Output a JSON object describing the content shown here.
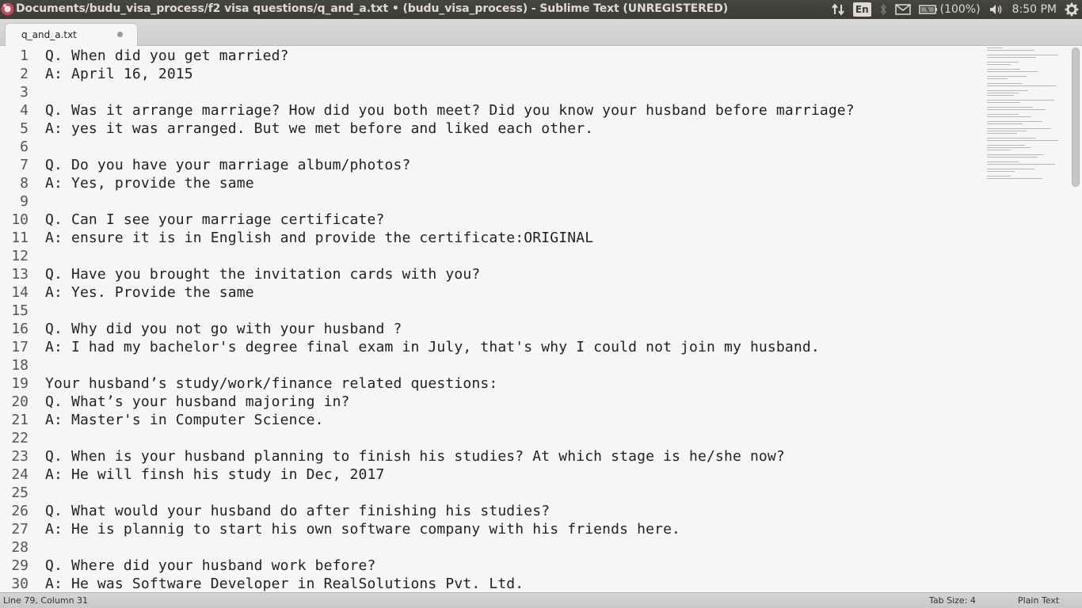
{
  "window": {
    "title": "Documents/budu_visa_process/f2 visa questions/q_and_a.txt • (budu_visa_process) - Sublime Text (UNREGISTERED)"
  },
  "tray": {
    "keyboard_layout": "En",
    "battery": "(100%)",
    "clock": "8:50 PM"
  },
  "tab": {
    "filename": "q_and_a.txt"
  },
  "editor": {
    "line_numbers": [
      "1",
      "2",
      "3",
      "4",
      "5",
      "6",
      "7",
      "8",
      "9",
      "10",
      "11",
      "12",
      "13",
      "14",
      "15",
      "16",
      "17",
      "18",
      "19",
      "20",
      "21",
      "22",
      "23",
      "24",
      "25",
      "26",
      "27",
      "28",
      "29",
      "30"
    ],
    "lines": [
      "Q. When did you get married?",
      "A: April 16, 2015",
      "",
      "Q. Was it arrange marriage? How did you both meet? Did you know your husband before marriage?",
      "A: yes it was arranged. But we met before and liked each other.",
      "",
      "Q. Do you have your marriage album/photos?",
      "A: Yes, provide the same",
      "",
      "Q. Can I see your marriage certificate?",
      "A: ensure it is in English and provide the certificate:ORIGINAL",
      "",
      "Q. Have you brought the invitation cards with you?",
      "A: Yes. Provide the same",
      "",
      "Q. Why did you not go with your husband ?",
      "A: I had my bachelor's degree final exam in July, that's why I could not join my husband.",
      "",
      "Your husband’s study/work/finance related questions:",
      "Q. What’s your husband majoring in?",
      "A: Master's in Computer Science.",
      "",
      "Q. When is your husband planning to finish his studies? At which stage is he/she now?",
      "A: He will finsh his study in Dec, 2017",
      "",
      "Q. What would your husband do after finishing his studies?",
      "A: He is plannig to start his own software company with his friends here.",
      "",
      "Q. Where did your husband work before?",
      "A: He was Software Developer in RealSolutions Pvt. Ltd."
    ]
  },
  "status": {
    "cursor_position": "Line 79, Column 31",
    "tab_size": "Tab Size: 4",
    "syntax": "Plain Text"
  },
  "icons": [
    "sublime-app-icon",
    "network-arrows-icon",
    "bluetooth-icon",
    "mail-icon",
    "battery-icon",
    "volume-icon",
    "gear-icon"
  ],
  "colors": {
    "panel": "#3c3b37",
    "editor_bg": "#f6f6f6",
    "text": "#222222"
  }
}
